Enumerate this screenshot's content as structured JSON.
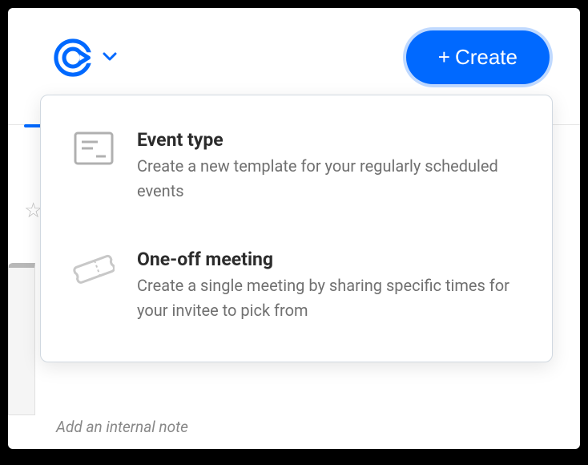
{
  "header": {
    "create_label": "Create",
    "create_prefix": "+"
  },
  "dropdown": {
    "items": [
      {
        "title": "Event type",
        "description": "Create a new template for your regularly scheduled events"
      },
      {
        "title": "One-off meeting",
        "description": "Create a single meeting by sharing specific times for your invitee to pick from"
      }
    ]
  },
  "footer": {
    "note_placeholder": "Add an internal note"
  },
  "colors": {
    "accent": "#0069ff"
  }
}
